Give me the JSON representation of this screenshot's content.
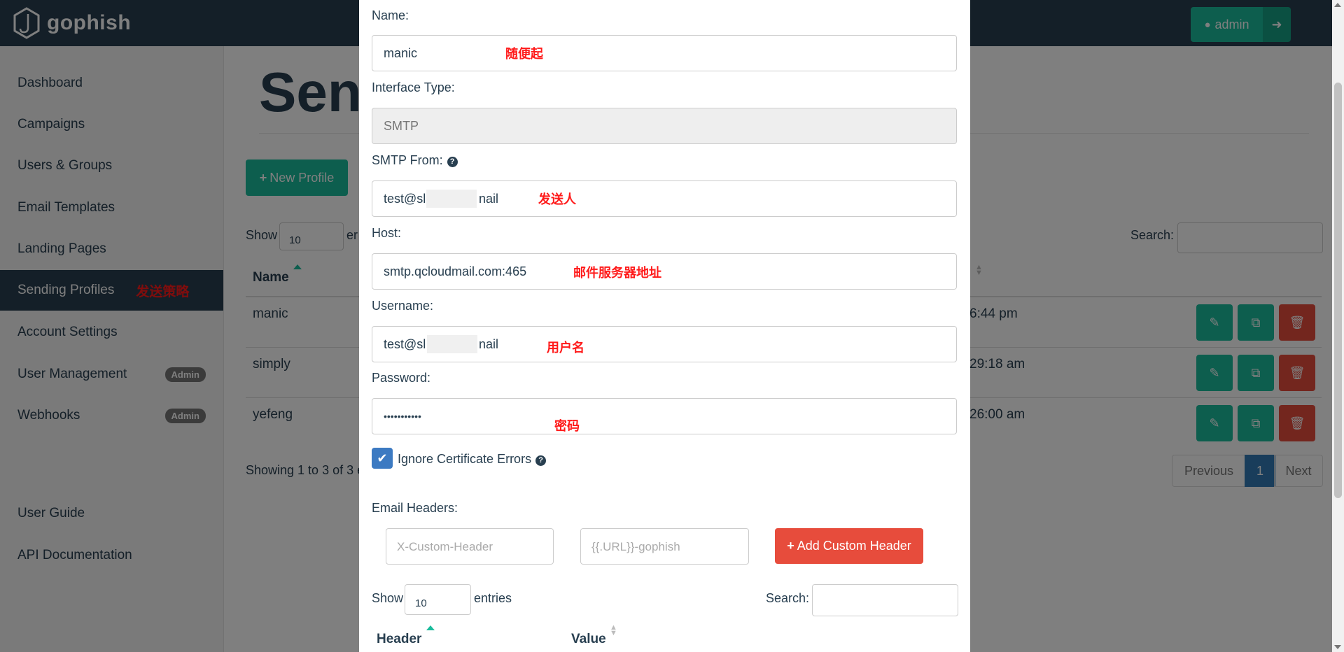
{
  "app": {
    "brand": "gophish",
    "admin_label": "admin"
  },
  "sidebar": {
    "items": [
      {
        "label": "Dashboard"
      },
      {
        "label": "Campaigns"
      },
      {
        "label": "Users & Groups"
      },
      {
        "label": "Email Templates"
      },
      {
        "label": "Landing Pages"
      },
      {
        "label": "Sending Profiles",
        "annotation": "发送策略"
      },
      {
        "label": "Account Settings"
      },
      {
        "label": "User Management",
        "badge": "Admin"
      },
      {
        "label": "Webhooks",
        "badge": "Admin"
      },
      {
        "label": "User Guide"
      },
      {
        "label": "API Documentation"
      }
    ]
  },
  "main": {
    "title_visible": "Sen",
    "new_profile_label": "New Profile",
    "show_label": "Show",
    "show_value": "10",
    "entries_partial": "er",
    "search_label": "Search:",
    "table_header": {
      "name": "Name"
    },
    "rows": [
      {
        "name": "manic",
        "time_partial": "6:44 pm"
      },
      {
        "name": "simply",
        "time_partial": "29:18 am"
      },
      {
        "name": "yefeng",
        "time_partial": "26:00 am"
      }
    ],
    "showing_text": "Showing 1 to 3 of 3 e",
    "pagination": {
      "previous": "Previous",
      "current": "1",
      "next": "Next"
    }
  },
  "modal": {
    "name_label": "Name:",
    "name_value": "manic",
    "name_annotation": "随便起",
    "interface_label": "Interface Type:",
    "interface_value": "SMTP",
    "smtp_from_label": "SMTP From:",
    "smtp_from_value_start": "test@sl",
    "smtp_from_value_end": "nail",
    "smtp_from_annotation": "发送人",
    "host_label": "Host:",
    "host_value": "smtp.qcloudmail.com:465",
    "host_annotation": "邮件服务器地址",
    "username_label": "Username:",
    "username_value_start": "test@sl",
    "username_value_end": "nail",
    "username_annotation": "用户名",
    "password_label": "Password:",
    "password_value": "•••••••••••",
    "password_annotation": "密码",
    "ignore_cert_label": "Ignore Certificate Errors",
    "ignore_cert_checked": true,
    "email_headers_label": "Email Headers:",
    "header_key_placeholder": "X-Custom-Header",
    "header_value_placeholder": "{{.URL}}-gophish",
    "add_header_label": "Add Custom Header",
    "show_label": "Show",
    "show_value": "10",
    "entries_label": "entries",
    "search_label": "Search:",
    "table_header": {
      "header": "Header",
      "value": "Value"
    }
  },
  "colors": {
    "navy": "#283f50",
    "teal": "#1abc9c",
    "red": "#e74c3c",
    "annotation": "#ff1a1a",
    "blue": "#337ab7"
  }
}
